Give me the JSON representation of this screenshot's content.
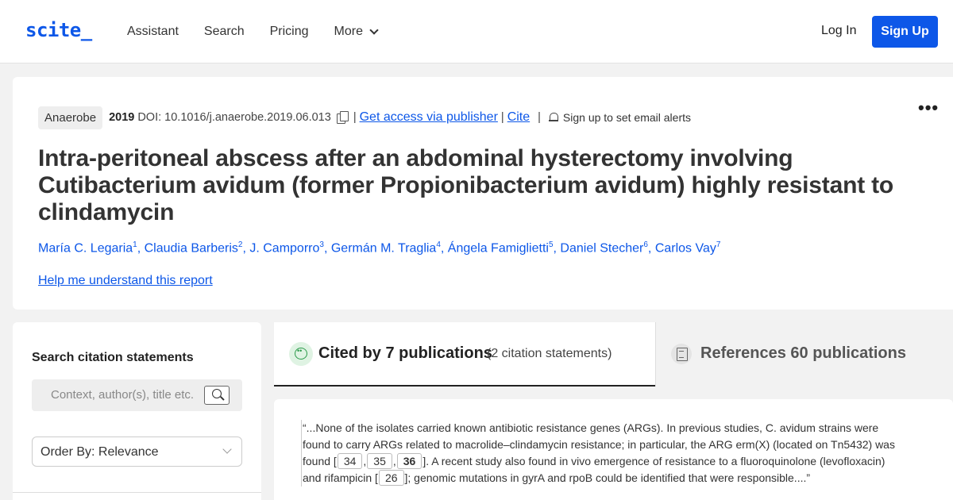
{
  "header": {
    "logo": "scite_",
    "nav": [
      "Assistant",
      "Search",
      "Pricing",
      "More"
    ],
    "login": "Log In",
    "signup": "Sign Up"
  },
  "paper": {
    "journal": "Anaerobe",
    "year": "2019",
    "doi": "DOI: 10.1016/j.anaerobe.2019.06.013",
    "access_link": "Get access via publisher",
    "cite_link": "Cite",
    "alert_text": "Sign up to set email alerts",
    "title": "Intra-peritoneal abscess after an abdominal hysterectomy involving Cutibacterium avidum (former Propionibacterium avidum) highly resistant to clindamycin",
    "authors": [
      {
        "name": "María C. Legaria",
        "sup": "1"
      },
      {
        "name": "Claudia Barberis",
        "sup": "2"
      },
      {
        "name": "J. Camporro",
        "sup": "3"
      },
      {
        "name": "Germán M. Traglia",
        "sup": "4"
      },
      {
        "name": "Ángela Famiglietti",
        "sup": "5"
      },
      {
        "name": "Daniel Stecher",
        "sup": "6"
      },
      {
        "name": "Carlos Vay",
        "sup": "7"
      }
    ],
    "help_link": "Help me understand this report"
  },
  "sidebar": {
    "search_title": "Search citation statements",
    "search_placeholder": "Context, author(s), title etc.",
    "order_by": "Order By: Relevance"
  },
  "tabs": {
    "cited_label": "Cited by 7 publications",
    "cited_count": "(2 citation statements)",
    "refs_label": "References 60 publications"
  },
  "citation": {
    "text_1": "“...None of the isolates carried known antibiotic resistance genes (ARGs). In previous studies, C. avidum strains were found to carry ARGs related to macrolide–clindamycin resistance; in particular, the ARG erm(X) (located on Tn5432) was found [",
    "refs_1": [
      "34",
      "35",
      "36"
    ],
    "text_2": "]. A recent study also found in vivo emergence of resistance to a fluoroquinolone (levofloxacin) and rifampicin [",
    "ref_2": "26",
    "text_3": "]; genomic mutations in gyrA and rpoB could be identified that were responsible....”"
  },
  "colors": {
    "accent": "#0d57e8",
    "supporting_green": "#2b9a4a"
  }
}
